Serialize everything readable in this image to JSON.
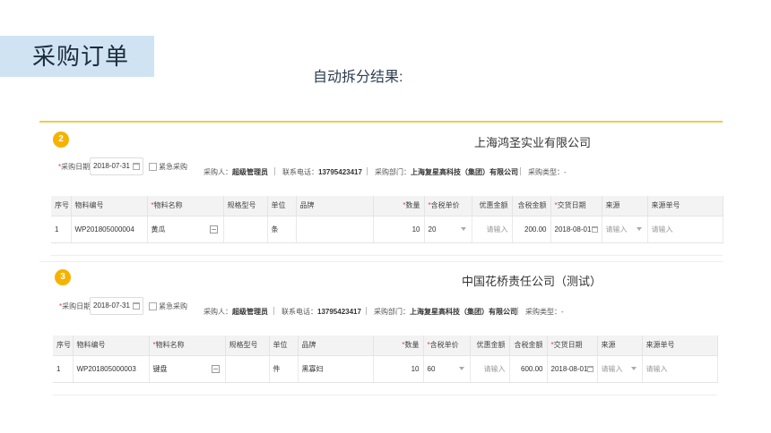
{
  "page": {
    "title": "采购订单",
    "subtitle": "自动拆分结果:"
  },
  "colors": {
    "accent": "#f5b300",
    "title_bg": "#cfe3f3",
    "required": "#e0403a"
  },
  "orders": [
    {
      "step": "2",
      "company": "上海鸿圣实业有限公司",
      "date_label_req": "*",
      "date_label": "采购日期",
      "date_value": "2018-07-31",
      "urgent_label": "紧急采购",
      "buyer_label": "采购人：",
      "buyer": "超级管理员",
      "phone_label": "联系电话：",
      "phone": "13795423417",
      "dept_label": "采购部门：",
      "dept": "上海复星高科技（集团）有限公司",
      "type_label": "采购类型：-",
      "columns": [
        "序号",
        "物料编号",
        "物料名称",
        "规格型号",
        "单位",
        "品牌",
        "数量",
        "含税单价",
        "优惠金额",
        "含税金额",
        "交货日期",
        "来源",
        "来源单号"
      ],
      "row": {
        "index": "1",
        "code": "WP201805000004",
        "name": "黄瓜",
        "spec": "",
        "unit": "条",
        "brand": "",
        "qty": "10",
        "price": "20",
        "discount_ph": "请输入",
        "amount": "200.00",
        "delivery": "2018-08-01",
        "source_ph": "请输入",
        "source_no_ph": "请输入"
      }
    },
    {
      "step": "3",
      "company": "中国花桥责任公司（测试）",
      "date_label_req": "*",
      "date_label": "采购日期",
      "date_value": "2018-07-31",
      "urgent_label": "紧急采购",
      "buyer_label": "采购人：",
      "buyer": "超级管理员",
      "phone_label": "联系电话：",
      "phone": "13795423417",
      "dept_label": "采购部门：",
      "dept": "上海复星高科技（集团）有限公司",
      "type_label": "采购类型：-",
      "columns": [
        "序号",
        "物料编号",
        "物料名称",
        "规格型号",
        "单位",
        "品牌",
        "数量",
        "含税单价",
        "优惠金额",
        "含税金额",
        "交货日期",
        "来源",
        "来源单号"
      ],
      "row": {
        "index": "1",
        "code": "WP201805000003",
        "name": "键盘",
        "spec": "",
        "unit": "件",
        "brand": "黑寡妇",
        "qty": "10",
        "price": "60",
        "discount_ph": "请输入",
        "amount": "600.00",
        "delivery": "2018-08-01",
        "source_ph": "请输入",
        "source_no_ph": "请输入"
      }
    }
  ]
}
